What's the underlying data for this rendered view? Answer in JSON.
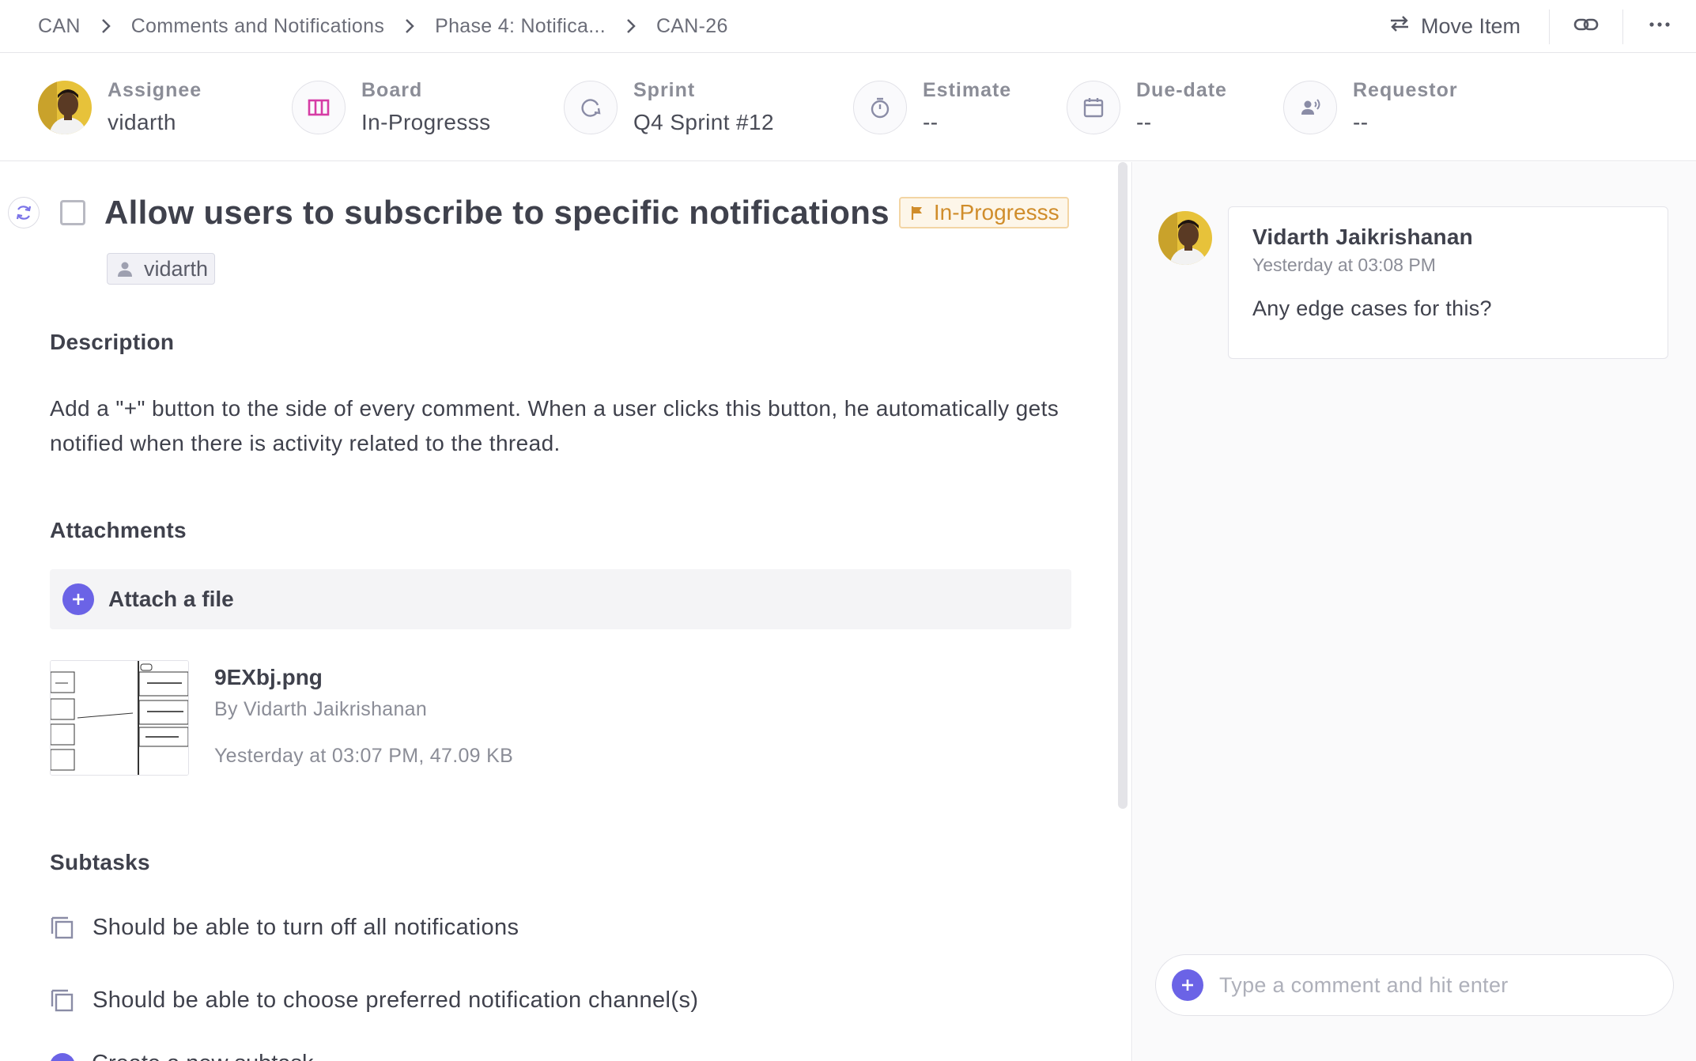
{
  "breadcrumb": {
    "items": [
      "CAN",
      "Comments and Notifications",
      "Phase 4: Notifica...",
      "CAN-26"
    ]
  },
  "toolbar": {
    "move_label": "Move Item",
    "link_icon": "link-icon",
    "more_icon": "more-horizontal-icon"
  },
  "meta": {
    "assignee": {
      "label": "Assignee",
      "value": "vidarth"
    },
    "board": {
      "label": "Board",
      "value": "In-Progresss",
      "icon": "board-columns-icon"
    },
    "sprint": {
      "label": "Sprint",
      "value": "Q4 Sprint #12",
      "icon": "sprint-cycle-icon"
    },
    "estimate": {
      "label": "Estimate",
      "value": "--",
      "icon": "stopwatch-icon"
    },
    "due_date": {
      "label": "Due-date",
      "value": "--",
      "icon": "calendar-icon"
    },
    "requestor": {
      "label": "Requestor",
      "value": "--",
      "icon": "requestor-icon"
    }
  },
  "item": {
    "title": "Allow users to subscribe to specific notifications",
    "status": "In-Progresss",
    "assignee_chip": "vidarth"
  },
  "description": {
    "heading": "Description",
    "text": "Add a \"+\" button to the side of every comment. When a user clicks this button, he automatically gets notified when there is activity related to the thread."
  },
  "attachments": {
    "heading": "Attachments",
    "attach_label": "Attach a file",
    "files": [
      {
        "name": "9EXbj.png",
        "by": "By Vidarth Jaikrishanan",
        "meta": "Yesterday at 03:07 PM, 47.09 KB"
      }
    ]
  },
  "subtasks": {
    "heading": "Subtasks",
    "items": [
      "Should be able to turn off all notifications",
      "Should be able to choose preferred notification channel(s)"
    ],
    "partial_item": "Create a new subtask"
  },
  "comments": {
    "items": [
      {
        "author": "Vidarth Jaikrishanan",
        "time": "Yesterday at 03:08 PM",
        "body": "Any edge cases for this?"
      }
    ],
    "input_placeholder": "Type a comment and hit enter"
  },
  "colors": {
    "accent": "#6b63e6",
    "status_text": "#d08d2b",
    "board_icon": "#d63ca5"
  }
}
